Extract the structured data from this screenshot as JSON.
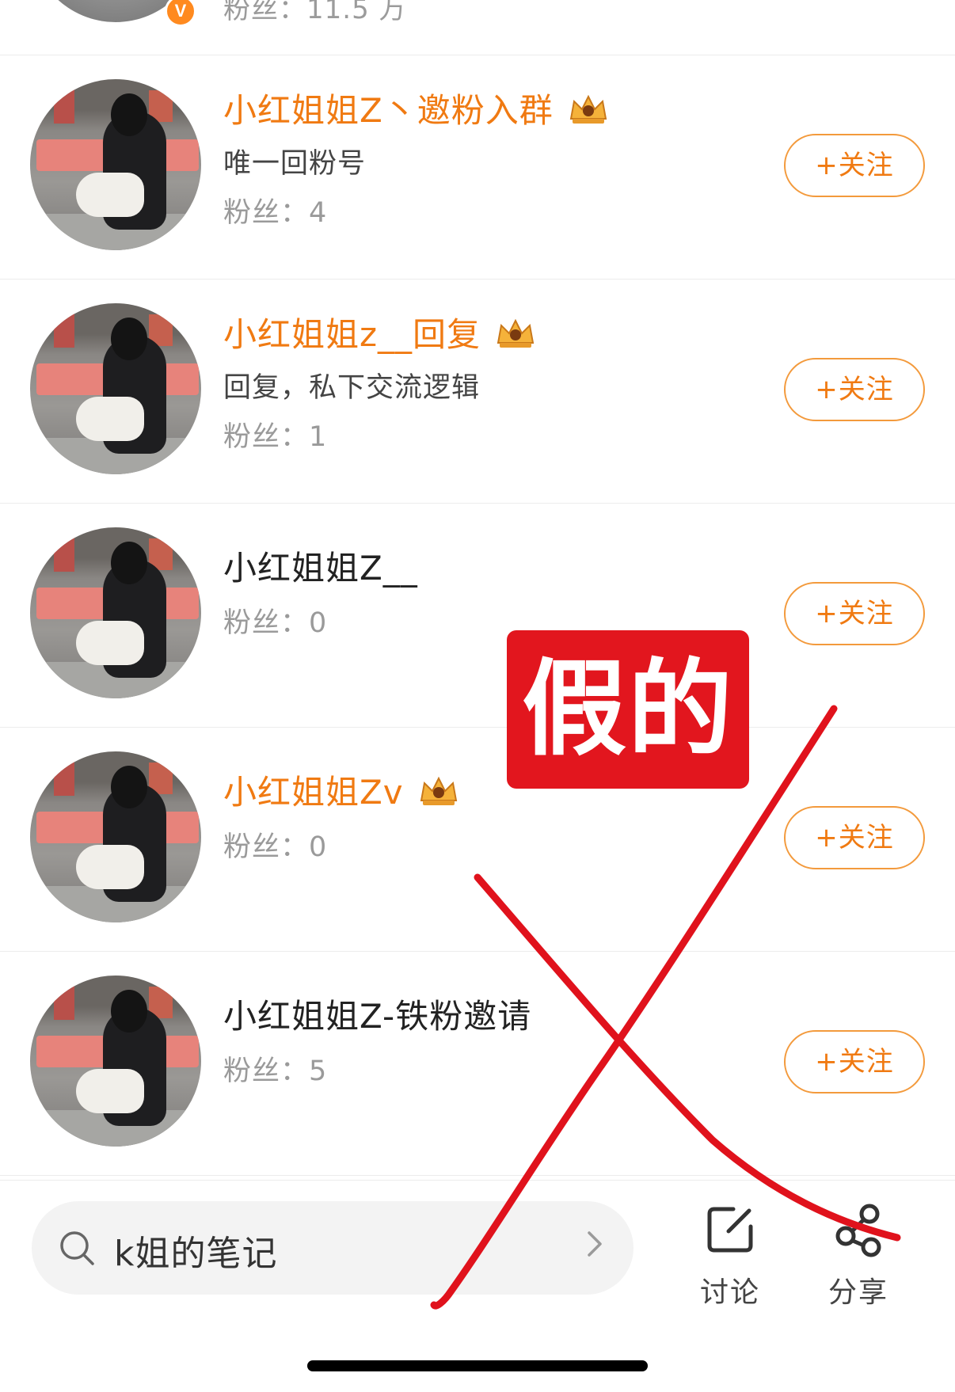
{
  "top_row": {
    "fans_label": "粉丝：11.5 万",
    "badge": "V"
  },
  "users": [
    {
      "name": "小红姐姐Z丶邀粉入群",
      "name_color": "orange",
      "has_crown": true,
      "desc": "唯一回粉号",
      "fans": "粉丝：4",
      "follow_label": "+关注"
    },
    {
      "name": "小红姐姐z__回复",
      "name_color": "orange",
      "has_crown": true,
      "desc": "回复，私下交流逻辑",
      "fans": "粉丝：1",
      "follow_label": "+关注"
    },
    {
      "name": "小红姐姐Z__",
      "name_color": "black",
      "has_crown": false,
      "desc": "",
      "fans": "粉丝：0",
      "follow_label": "+关注"
    },
    {
      "name": "小红姐姐Zv",
      "name_color": "orange",
      "has_crown": true,
      "desc": "",
      "fans": "粉丝：0",
      "follow_label": "+关注"
    },
    {
      "name": "小红姐姐Z-铁粉邀请",
      "name_color": "black",
      "has_crown": false,
      "desc": "",
      "fans": "粉丝：5",
      "follow_label": "+关注"
    }
  ],
  "bottom_bar": {
    "search_text": "k姐的笔记",
    "discuss_label": "讨论",
    "share_label": "分享"
  },
  "overlay": {
    "stamp_text": "假的",
    "stamp_color": "#e2161e",
    "cross_color": "#e0121c"
  },
  "colors": {
    "accent": "#f07a12",
    "border": "#f39a3c"
  },
  "icons": [
    "verified-badge-icon",
    "crown-icon",
    "search-icon",
    "chevron-right-icon",
    "edit-icon",
    "share-icon"
  ]
}
